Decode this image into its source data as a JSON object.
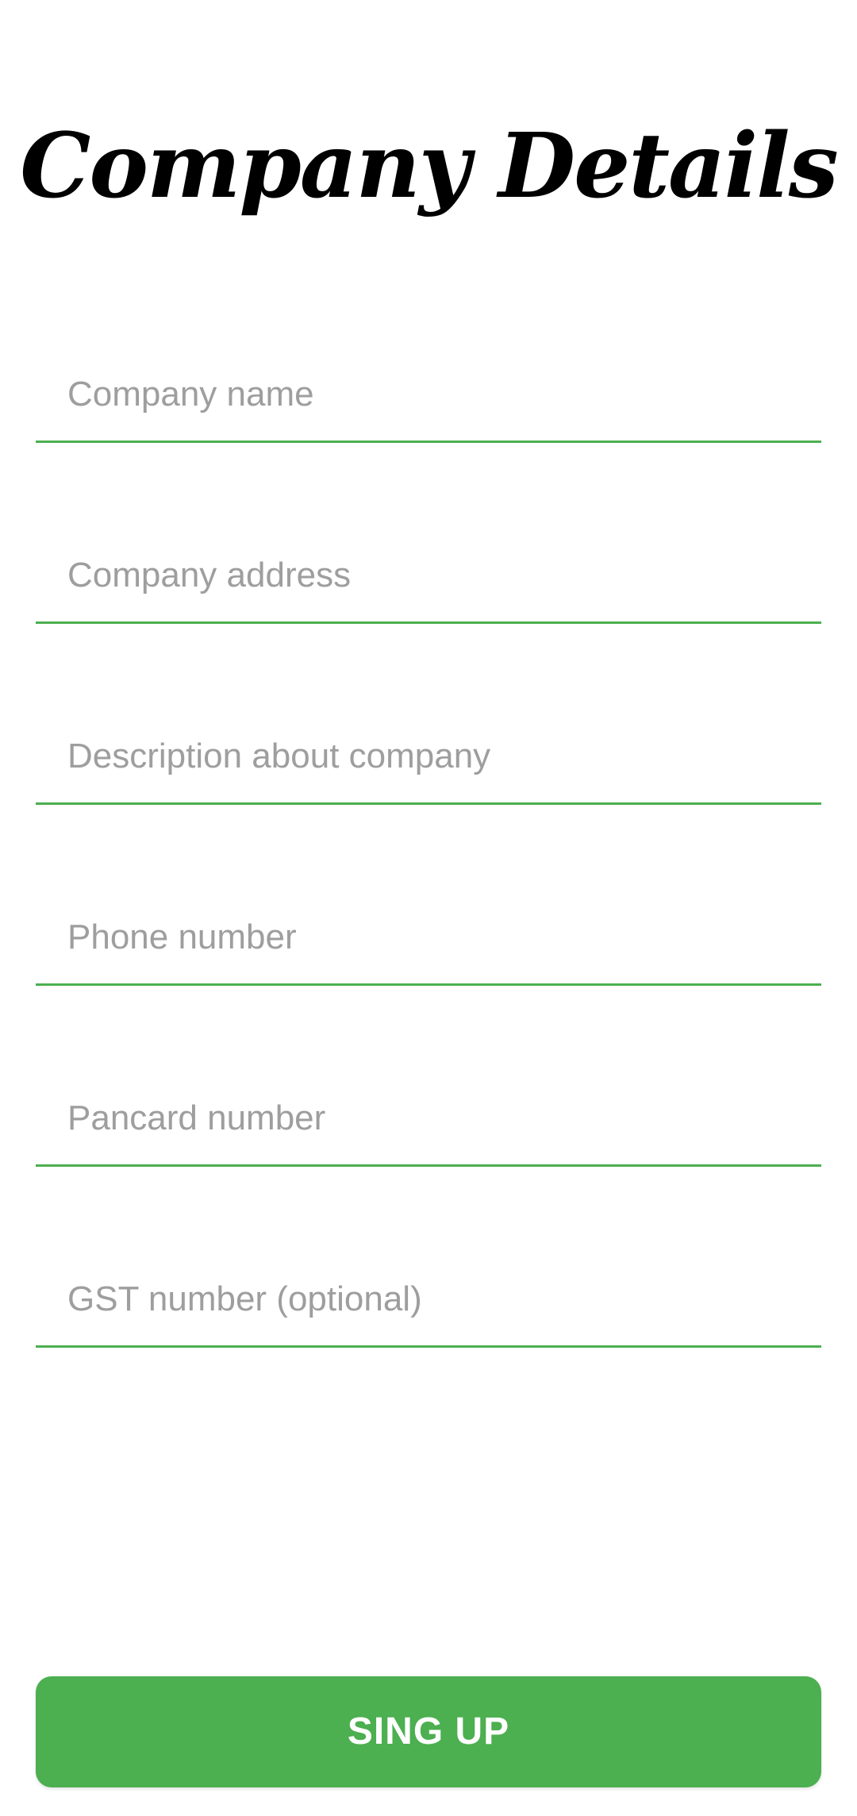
{
  "title": "Company Details",
  "form": {
    "fields": [
      {
        "placeholder": "Company name",
        "value": ""
      },
      {
        "placeholder": "Company address",
        "value": ""
      },
      {
        "placeholder": "Description about company",
        "value": ""
      },
      {
        "placeholder": "Phone number",
        "value": ""
      },
      {
        "placeholder": "Pancard number",
        "value": ""
      },
      {
        "placeholder": "GST number (optional)",
        "value": ""
      }
    ],
    "submit_label": "SING UP"
  },
  "colors": {
    "accent": "#4caf50",
    "placeholder": "#9e9e9e",
    "title": "#000000",
    "background": "#ffffff"
  }
}
